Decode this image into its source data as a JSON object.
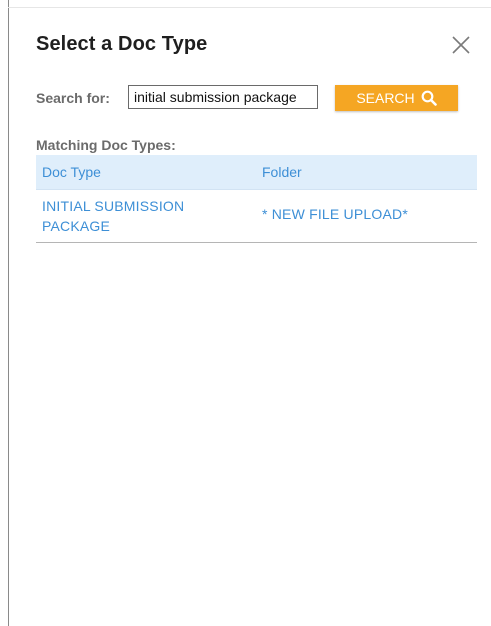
{
  "dialog": {
    "title": "Select a Doc Type",
    "close_icon": "close-icon"
  },
  "search": {
    "label": "Search for:",
    "value": "initial submission package",
    "button_label": "SEARCH",
    "button_icon": "search-icon",
    "button_color": "#f5a623"
  },
  "results": {
    "label": "Matching Doc Types:",
    "columns": [
      "Doc Type",
      "Folder"
    ],
    "rows": [
      {
        "doc_type": "INITIAL SUBMISSION PACKAGE",
        "folder": "* NEW FILE UPLOAD*"
      }
    ],
    "header_bg": "#dfeefb",
    "link_color": "#3d8fd6"
  }
}
